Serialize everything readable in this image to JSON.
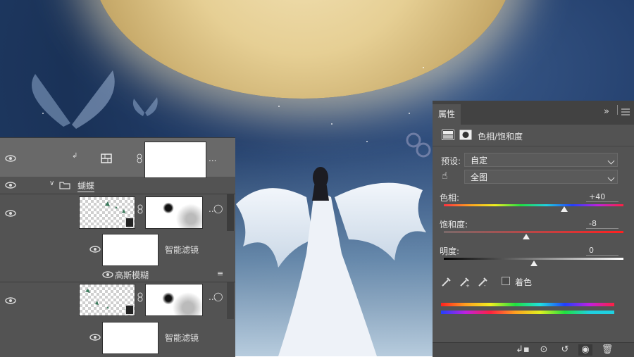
{
  "layers": {
    "rows": [
      {
        "name": "group-butterfly",
        "label": "蝴蝶"
      },
      {
        "name": "smart-filter-1",
        "label": "智能滤镜"
      },
      {
        "name": "gaussian-blur",
        "label": "高斯模糊"
      },
      {
        "name": "smart-filter-2",
        "label": "智能滤镜"
      }
    ],
    "more_label": "..."
  },
  "properties": {
    "tab_label": "属性",
    "title": "色相/饱和度",
    "preset_label": "预设:",
    "preset_value": "自定",
    "channel_value": "全图",
    "hue_label": "色相:",
    "hue_value": "+40",
    "hue_level": 0.67,
    "saturation_label": "饱和度:",
    "saturation_value": "-8",
    "saturation_level": 0.46,
    "lightness_label": "明度:",
    "lightness_value": "0",
    "lightness_level": 0.5,
    "colorize_label": "着色",
    "collapse_glyph": "»"
  },
  "colors": {
    "panel_bg": "#535353",
    "panel_dark": "#424242",
    "selected_row": "#696969"
  }
}
